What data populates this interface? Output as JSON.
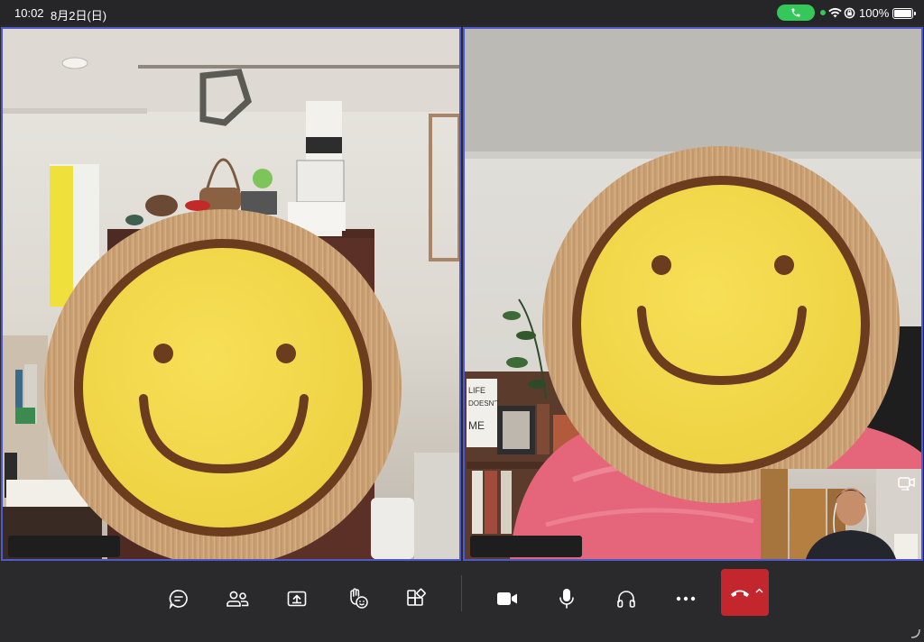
{
  "status_bar": {
    "time": "10:02",
    "date": "8月2日(日)",
    "battery": "100%",
    "icons": [
      "phone-icon",
      "wifi-icon",
      "rotation-lock-icon",
      "battery-icon"
    ]
  },
  "participants": [
    {
      "tile": "left",
      "avatar": "smiley-face"
    },
    {
      "tile": "right",
      "avatar": "smiley-face"
    }
  ],
  "self_view": {
    "icon": "switch-camera-icon"
  },
  "toolbar": {
    "buttons": [
      {
        "name": "chat",
        "icon": "chat-bubble-icon"
      },
      {
        "name": "people",
        "icon": "participants-icon"
      },
      {
        "name": "share",
        "icon": "share-screen-icon"
      },
      {
        "name": "reactions",
        "icon": "reactions-icon"
      },
      {
        "name": "apps",
        "icon": "apps-icon"
      },
      {
        "name": "camera",
        "icon": "video-camera-icon"
      },
      {
        "name": "mic",
        "icon": "microphone-icon"
      },
      {
        "name": "audio",
        "icon": "headphones-icon"
      },
      {
        "name": "more",
        "icon": "more-icon"
      },
      {
        "name": "leave",
        "icon": "hang-up-icon"
      }
    ]
  },
  "colors": {
    "tile_border": "#5059c9",
    "hangup": "#c4262e",
    "call_pill": "#34c759",
    "smiley_face": "#f2d64a",
    "smiley_ring": "#6b3c1e",
    "smiley_wood": "#caa276"
  }
}
